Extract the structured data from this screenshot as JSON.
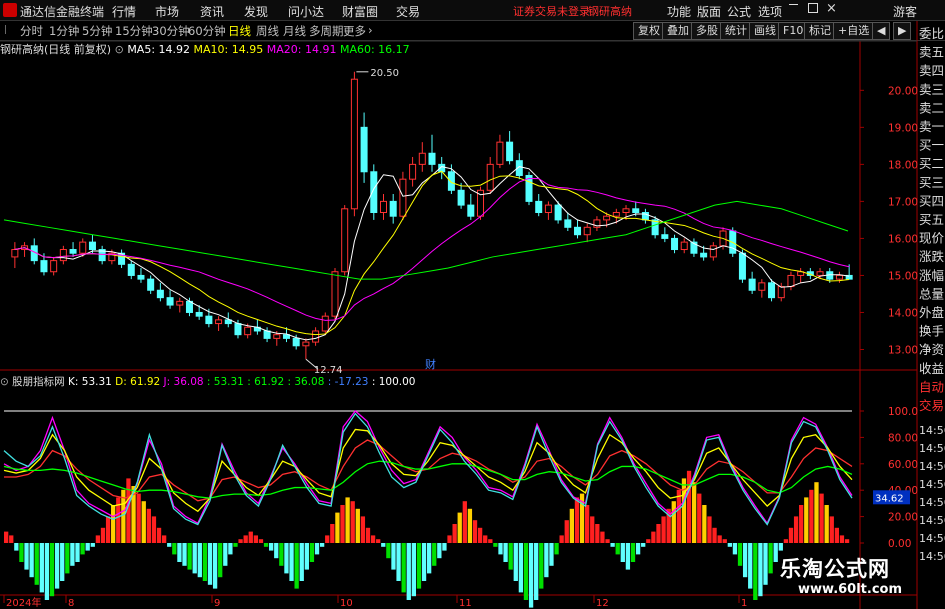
{
  "app": {
    "title": "通达信金融终端",
    "menu": [
      "行情",
      "市场",
      "资讯",
      "发现",
      "问小达",
      "财富圈",
      "交易"
    ],
    "login_status": "证券交易未登录",
    "stock_name": "钢研高纳",
    "right_menu": [
      "功能",
      "版面",
      "公式",
      "选项"
    ],
    "guest": "游客"
  },
  "toolbar": {
    "periods": [
      "分时",
      "1分钟",
      "5分钟",
      "15分钟",
      "30分钟",
      "60分钟",
      "日线",
      "周线",
      "月线",
      "多周期",
      "更多"
    ],
    "selected_period": "日线",
    "buttons": [
      "复权",
      "叠加",
      "多股",
      "统计",
      "画线",
      "F10",
      "标记",
      "+自选",
      "◀",
      "▶"
    ]
  },
  "info_line": {
    "stock": "钢研高纳",
    "mode": "(日线 前复权)",
    "ma5": "MA5: 14.92",
    "ma10": "MA10: 14.95",
    "ma20": "MA20: 14.91",
    "ma60": "MA60: 16.17",
    "colors": {
      "stock": "#dddddd",
      "ma5": "#ffffff",
      "ma10": "#ffff00",
      "ma20": "#ff00ff",
      "ma60": "#00ff00"
    }
  },
  "price_axis": {
    "labels": [
      "20.00",
      "19.00",
      "18.00",
      "17.00",
      "16.00",
      "15.00",
      "14.00",
      "13.00"
    ],
    "high_label": "20.50",
    "low_label": "12.74"
  },
  "side_panel": [
    "委比",
    "卖五",
    "卖四",
    "卖三",
    "卖二",
    "卖一",
    "买一",
    "买二",
    "买三",
    "买四",
    "买五",
    "现价",
    "涨跌",
    "涨幅",
    "总量",
    "外盘",
    "换手",
    "净资",
    "收益",
    "自动",
    "交易"
  ],
  "side_panel_alt": [
    "14:56",
    "14:56",
    "14:56",
    "14:56",
    "14:56",
    "14:56",
    "14:56",
    "14:56"
  ],
  "indicator": {
    "name": "股朋指标网",
    "values": [
      {
        "text": "K: 53.31",
        "color": "#ffffff"
      },
      {
        "text": "D: 61.92",
        "color": "#ffff00"
      },
      {
        "text": "J: 36.08",
        "color": "#ff00ff"
      },
      {
        "text": ": 53.31",
        "color": "#00ff00"
      },
      {
        "text": ": 61.92",
        "color": "#00ff00"
      },
      {
        "text": ": 36.08",
        "color": "#00ff00"
      },
      {
        "text": ": -17.23",
        "color": "#4080ff"
      },
      {
        "text": ": 100.00",
        "color": "#ffffff"
      }
    ],
    "axis_labels": [
      "100.0",
      "80.00",
      "60.00",
      "40.00",
      "20.00",
      "0.00"
    ],
    "current_value": "34.62"
  },
  "date_axis": {
    "labels": [
      "2024年",
      "8",
      "9",
      "10",
      "11",
      "12",
      "1"
    ]
  },
  "finance_mark": "财",
  "watermark": {
    "line1": "乐淘公式网",
    "line2": "www.60lt.com"
  },
  "chart_data": {
    "type": "candlestick",
    "price_range": [
      12.5,
      20.9
    ],
    "indicator_range": [
      0,
      100
    ],
    "reference_line": 100,
    "candles": [
      {
        "o": 15.5,
        "h": 15.9,
        "l": 15.2,
        "c": 15.7
      },
      {
        "o": 15.7,
        "h": 15.9,
        "l": 15.5,
        "c": 15.8
      },
      {
        "o": 15.8,
        "h": 16.0,
        "l": 15.3,
        "c": 15.4
      },
      {
        "o": 15.4,
        "h": 15.6,
        "l": 15.0,
        "c": 15.1
      },
      {
        "o": 15.1,
        "h": 15.5,
        "l": 15.0,
        "c": 15.4
      },
      {
        "o": 15.4,
        "h": 15.8,
        "l": 15.3,
        "c": 15.7
      },
      {
        "o": 15.7,
        "h": 15.9,
        "l": 15.5,
        "c": 15.6
      },
      {
        "o": 15.6,
        "h": 16.0,
        "l": 15.5,
        "c": 15.9
      },
      {
        "o": 15.9,
        "h": 16.1,
        "l": 15.6,
        "c": 15.7
      },
      {
        "o": 15.7,
        "h": 15.8,
        "l": 15.3,
        "c": 15.4
      },
      {
        "o": 15.4,
        "h": 15.7,
        "l": 15.3,
        "c": 15.6
      },
      {
        "o": 15.6,
        "h": 15.7,
        "l": 15.2,
        "c": 15.3
      },
      {
        "o": 15.3,
        "h": 15.4,
        "l": 14.9,
        "c": 15.0
      },
      {
        "o": 15.0,
        "h": 15.2,
        "l": 14.8,
        "c": 14.9
      },
      {
        "o": 14.9,
        "h": 15.0,
        "l": 14.5,
        "c": 14.6
      },
      {
        "o": 14.6,
        "h": 14.8,
        "l": 14.3,
        "c": 14.4
      },
      {
        "o": 14.4,
        "h": 14.6,
        "l": 14.1,
        "c": 14.2
      },
      {
        "o": 14.2,
        "h": 14.4,
        "l": 14.0,
        "c": 14.3
      },
      {
        "o": 14.3,
        "h": 14.4,
        "l": 13.9,
        "c": 14.0
      },
      {
        "o": 14.0,
        "h": 14.2,
        "l": 13.8,
        "c": 13.9
      },
      {
        "o": 13.9,
        "h": 14.1,
        "l": 13.6,
        "c": 13.7
      },
      {
        "o": 13.7,
        "h": 13.9,
        "l": 13.5,
        "c": 13.8
      },
      {
        "o": 13.8,
        "h": 14.0,
        "l": 13.6,
        "c": 13.7
      },
      {
        "o": 13.7,
        "h": 13.8,
        "l": 13.3,
        "c": 13.4
      },
      {
        "o": 13.4,
        "h": 13.7,
        "l": 13.3,
        "c": 13.6
      },
      {
        "o": 13.6,
        "h": 13.8,
        "l": 13.4,
        "c": 13.5
      },
      {
        "o": 13.5,
        "h": 13.6,
        "l": 13.2,
        "c": 13.3
      },
      {
        "o": 13.3,
        "h": 13.5,
        "l": 13.1,
        "c": 13.4
      },
      {
        "o": 13.4,
        "h": 13.6,
        "l": 13.2,
        "c": 13.3
      },
      {
        "o": 13.3,
        "h": 13.4,
        "l": 13.0,
        "c": 13.1
      },
      {
        "o": 13.1,
        "h": 13.3,
        "l": 12.74,
        "c": 13.2
      },
      {
        "o": 13.2,
        "h": 13.6,
        "l": 13.1,
        "c": 13.5
      },
      {
        "o": 13.5,
        "h": 14.0,
        "l": 13.4,
        "c": 13.9
      },
      {
        "o": 13.9,
        "h": 15.2,
        "l": 13.8,
        "c": 15.1
      },
      {
        "o": 15.1,
        "h": 16.9,
        "l": 15.0,
        "c": 16.8
      },
      {
        "o": 16.8,
        "h": 20.5,
        "l": 16.6,
        "c": 20.3
      },
      {
        "o": 19.0,
        "h": 19.4,
        "l": 17.5,
        "c": 17.8
      },
      {
        "o": 17.8,
        "h": 18.0,
        "l": 16.5,
        "c": 16.7
      },
      {
        "o": 16.7,
        "h": 17.2,
        "l": 16.5,
        "c": 17.0
      },
      {
        "o": 17.0,
        "h": 17.2,
        "l": 16.4,
        "c": 16.6
      },
      {
        "o": 16.6,
        "h": 17.8,
        "l": 16.5,
        "c": 17.6
      },
      {
        "o": 17.6,
        "h": 18.2,
        "l": 17.4,
        "c": 18.0
      },
      {
        "o": 18.0,
        "h": 18.6,
        "l": 17.8,
        "c": 18.3
      },
      {
        "o": 18.3,
        "h": 18.8,
        "l": 17.8,
        "c": 18.0
      },
      {
        "o": 18.0,
        "h": 18.2,
        "l": 17.6,
        "c": 17.8
      },
      {
        "o": 17.8,
        "h": 18.0,
        "l": 17.2,
        "c": 17.3
      },
      {
        "o": 17.3,
        "h": 17.5,
        "l": 16.8,
        "c": 16.9
      },
      {
        "o": 16.9,
        "h": 17.2,
        "l": 16.5,
        "c": 16.6
      },
      {
        "o": 16.6,
        "h": 17.4,
        "l": 16.5,
        "c": 17.3
      },
      {
        "o": 17.3,
        "h": 18.2,
        "l": 17.2,
        "c": 18.0
      },
      {
        "o": 18.0,
        "h": 18.8,
        "l": 17.9,
        "c": 18.6
      },
      {
        "o": 18.6,
        "h": 18.9,
        "l": 18.0,
        "c": 18.1
      },
      {
        "o": 18.1,
        "h": 18.3,
        "l": 17.6,
        "c": 17.7
      },
      {
        "o": 17.7,
        "h": 17.8,
        "l": 16.9,
        "c": 17.0
      },
      {
        "o": 17.0,
        "h": 17.2,
        "l": 16.6,
        "c": 16.7
      },
      {
        "o": 16.7,
        "h": 17.0,
        "l": 16.5,
        "c": 16.9
      },
      {
        "o": 16.9,
        "h": 17.0,
        "l": 16.4,
        "c": 16.5
      },
      {
        "o": 16.5,
        "h": 16.7,
        "l": 16.2,
        "c": 16.3
      },
      {
        "o": 16.3,
        "h": 16.5,
        "l": 16.0,
        "c": 16.1
      },
      {
        "o": 16.1,
        "h": 16.4,
        "l": 15.9,
        "c": 16.3
      },
      {
        "o": 16.3,
        "h": 16.6,
        "l": 16.2,
        "c": 16.5
      },
      {
        "o": 16.5,
        "h": 16.7,
        "l": 16.3,
        "c": 16.6
      },
      {
        "o": 16.6,
        "h": 16.8,
        "l": 16.4,
        "c": 16.7
      },
      {
        "o": 16.7,
        "h": 16.9,
        "l": 16.5,
        "c": 16.8
      },
      {
        "o": 16.8,
        "h": 17.0,
        "l": 16.6,
        "c": 16.7
      },
      {
        "o": 16.7,
        "h": 16.8,
        "l": 16.4,
        "c": 16.5
      },
      {
        "o": 16.5,
        "h": 16.6,
        "l": 16.0,
        "c": 16.1
      },
      {
        "o": 16.1,
        "h": 16.3,
        "l": 15.9,
        "c": 16.0
      },
      {
        "o": 16.0,
        "h": 16.1,
        "l": 15.6,
        "c": 15.7
      },
      {
        "o": 15.7,
        "h": 16.0,
        "l": 15.6,
        "c": 15.9
      },
      {
        "o": 15.9,
        "h": 16.0,
        "l": 15.5,
        "c": 15.6
      },
      {
        "o": 15.6,
        "h": 15.8,
        "l": 15.4,
        "c": 15.5
      },
      {
        "o": 15.5,
        "h": 15.9,
        "l": 15.4,
        "c": 15.8
      },
      {
        "o": 15.8,
        "h": 16.3,
        "l": 15.7,
        "c": 16.2
      },
      {
        "o": 16.2,
        "h": 16.3,
        "l": 15.5,
        "c": 15.6
      },
      {
        "o": 15.6,
        "h": 15.7,
        "l": 14.8,
        "c": 14.9
      },
      {
        "o": 14.9,
        "h": 15.1,
        "l": 14.5,
        "c": 14.6
      },
      {
        "o": 14.6,
        "h": 14.9,
        "l": 14.4,
        "c": 14.8
      },
      {
        "o": 14.8,
        "h": 14.9,
        "l": 14.3,
        "c": 14.4
      },
      {
        "o": 14.4,
        "h": 14.8,
        "l": 14.3,
        "c": 14.7
      },
      {
        "o": 14.7,
        "h": 15.1,
        "l": 14.6,
        "c": 15.0
      },
      {
        "o": 15.0,
        "h": 15.2,
        "l": 14.8,
        "c": 15.1
      },
      {
        "o": 15.1,
        "h": 15.2,
        "l": 14.9,
        "c": 15.0
      },
      {
        "o": 15.0,
        "h": 15.2,
        "l": 14.9,
        "c": 15.1
      },
      {
        "o": 15.1,
        "h": 15.2,
        "l": 14.8,
        "c": 14.9
      },
      {
        "o": 14.9,
        "h": 15.1,
        "l": 14.8,
        "c": 15.0
      },
      {
        "o": 15.0,
        "h": 15.3,
        "l": 14.9,
        "c": 14.9
      }
    ],
    "ma_series": [
      {
        "name": "MA5",
        "color": "#ffffff",
        "window": 5
      },
      {
        "name": "MA10",
        "color": "#ffff00",
        "window": 10
      },
      {
        "name": "MA20",
        "color": "#ff00ff",
        "window": 20
      },
      {
        "name": "MA60",
        "color": "#00ff00",
        "points": [
          16.5,
          16.4,
          16.3,
          16.2,
          16.1,
          16.0,
          15.9,
          15.8,
          15.7,
          15.6,
          15.5,
          15.4,
          15.3,
          15.2,
          15.1,
          15.0,
          14.9,
          14.9,
          15.0,
          15.1,
          15.2,
          15.35,
          15.5,
          15.6,
          15.7,
          15.8,
          15.9,
          16.0,
          16.1,
          16.3,
          16.5,
          16.7,
          16.9,
          17.0,
          16.9,
          16.8,
          16.6,
          16.4,
          16.2
        ]
      },
      {
        "name": "MA60-note",
        "color": "#00ff00",
        "points": []
      }
    ],
    "indicator_series": [
      {
        "name": "J",
        "color": "#ff00ff",
        "points": [
          60,
          55,
          58,
          70,
          95,
          70,
          40,
          30,
          25,
          20,
          25,
          45,
          78,
          60,
          28,
          20,
          15,
          35,
          75,
          55,
          38,
          30,
          50,
          72,
          60,
          45,
          32,
          30,
          88,
          100,
          92,
          72,
          55,
          45,
          48,
          68,
          88,
          80,
          65,
          55,
          42,
          40,
          35,
          60,
          90,
          70,
          48,
          35,
          30,
          75,
          95,
          80,
          60,
          45,
          30,
          22,
          30,
          52,
          80,
          82,
          60,
          42,
          28,
          15,
          35,
          78,
          95,
          90,
          72,
          50,
          36
        ]
      },
      {
        "name": "D",
        "color": "#ff3030",
        "points": [
          50,
          50,
          52,
          58,
          70,
          66,
          56,
          48,
          42,
          36,
          34,
          38,
          50,
          52,
          44,
          38,
          32,
          34,
          48,
          50,
          46,
          42,
          44,
          52,
          54,
          50,
          44,
          40,
          58,
          72,
          78,
          74,
          66,
          58,
          54,
          56,
          64,
          68,
          66,
          62,
          56,
          52,
          46,
          50,
          62,
          64,
          58,
          50,
          44,
          52,
          66,
          70,
          66,
          60,
          52,
          44,
          40,
          44,
          56,
          62,
          60,
          54,
          46,
          38,
          38,
          50,
          64,
          72,
          70,
          64,
          58
        ]
      },
      {
        "name": "K",
        "color": "#ffff00",
        "points": [
          55,
          53,
          55,
          64,
          82,
          70,
          50,
          40,
          34,
          28,
          30,
          42,
          64,
          56,
          38,
          30,
          24,
          34,
          62,
          52,
          42,
          36,
          48,
          62,
          58,
          48,
          38,
          35,
          72,
          86,
          85,
          74,
          60,
          52,
          51,
          62,
          76,
          74,
          66,
          58,
          50,
          46,
          40,
          54,
          76,
          68,
          54,
          44,
          38,
          64,
          82,
          76,
          64,
          54,
          42,
          34,
          36,
          48,
          68,
          72,
          60,
          48,
          38,
          28,
          36,
          64,
          80,
          82,
          72,
          58,
          48
        ]
      },
      {
        "name": "Green",
        "color": "#00ff00",
        "points": [
          58,
          56,
          55,
          55,
          56,
          55,
          53,
          50,
          47,
          44,
          41,
          39,
          40,
          40,
          39,
          37,
          35,
          34,
          36,
          37,
          37,
          36,
          37,
          40,
          42,
          42,
          41,
          40,
          46,
          54,
          60,
          62,
          61,
          58,
          56,
          56,
          58,
          60,
          60,
          58,
          55,
          52,
          48,
          48,
          52,
          54,
          53,
          50,
          47,
          48,
          54,
          58,
          58,
          56,
          52,
          48,
          44,
          44,
          48,
          52,
          52,
          50,
          46,
          40,
          38,
          42,
          50,
          56,
          58,
          56,
          52
        ]
      },
      {
        "name": "Cyan",
        "color": "#40e0e0",
        "points": [
          70,
          62,
          58,
          66,
          88,
          64,
          36,
          28,
          22,
          18,
          22,
          46,
          82,
          56,
          26,
          18,
          14,
          32,
          74,
          52,
          36,
          28,
          48,
          74,
          58,
          42,
          30,
          28,
          84,
          98,
          88,
          68,
          50,
          42,
          46,
          66,
          86,
          76,
          62,
          52,
          40,
          38,
          33,
          58,
          88,
          66,
          46,
          34,
          28,
          74,
          92,
          78,
          58,
          42,
          28,
          20,
          28,
          50,
          78,
          80,
          58,
          40,
          26,
          14,
          34,
          76,
          92,
          88,
          70,
          48,
          34
        ]
      }
    ],
    "histogram": [
      6,
      4,
      -4,
      -10,
      -14,
      -18,
      -22,
      -26,
      -30,
      -28,
      -24,
      -20,
      -16,
      -12,
      -10,
      -6,
      -4,
      -2,
      4,
      8,
      14,
      20,
      24,
      28,
      34,
      30,
      26,
      22,
      18,
      14,
      8,
      4,
      -2,
      -6,
      -10,
      -12,
      -14,
      -16,
      -18,
      -20,
      -22,
      -24,
      -18,
      -12,
      -6,
      -2,
      2,
      4,
      6,
      4,
      2,
      -2,
      -4,
      -8,
      -12,
      -16,
      -20,
      -24,
      -20,
      -14,
      -10,
      -6,
      -2,
      4,
      10,
      16,
      20,
      24,
      22,
      18,
      14,
      8,
      4,
      2,
      -2,
      -8,
      -14,
      -20,
      -26,
      -30,
      -28,
      -24,
      -20,
      -16,
      -12,
      -8,
      -4,
      4,
      10,
      16,
      22,
      18,
      12,
      8,
      4,
      2,
      -2,
      -6,
      -10,
      -14,
      -20,
      -26,
      -30,
      -34,
      -30,
      -24,
      -18,
      -12,
      -6,
      4,
      12,
      18,
      24,
      26,
      20,
      14,
      10,
      6,
      2,
      -2,
      -6,
      -10,
      -14,
      -10,
      -6,
      -2,
      2,
      6,
      10,
      14,
      18,
      22,
      28,
      34,
      38,
      32,
      26,
      20,
      14,
      8,
      4,
      2,
      -2,
      -6,
      -12,
      -18,
      -24,
      -30,
      -28,
      -22,
      -16,
      -10,
      -4,
      2,
      8,
      14,
      20,
      24,
      28,
      32,
      26,
      20,
      14,
      8,
      4,
      2
    ]
  }
}
